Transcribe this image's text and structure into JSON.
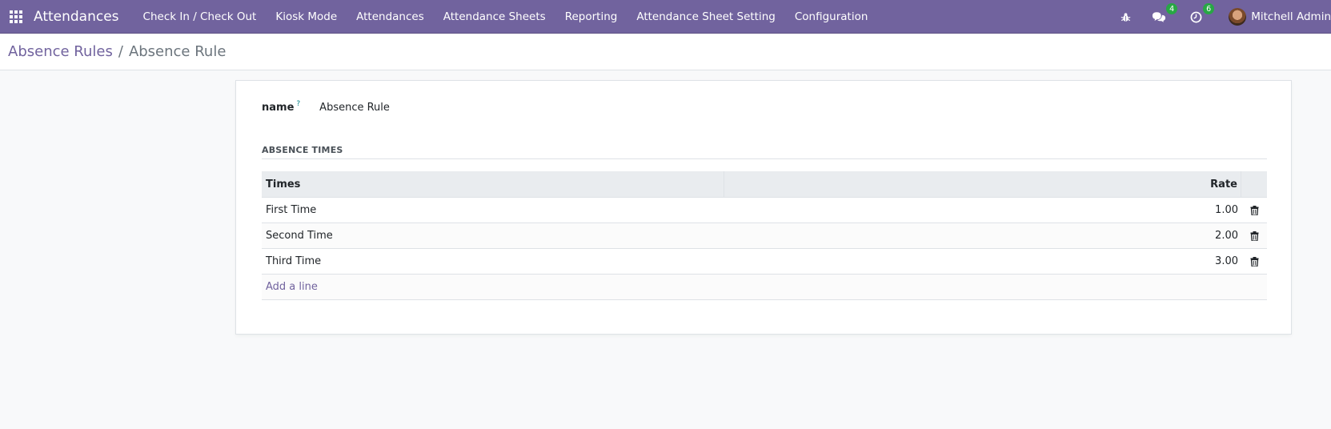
{
  "navbar": {
    "brand": "Attendances",
    "menu": [
      "Check In / Check Out",
      "Kiosk Mode",
      "Attendances",
      "Attendance Sheets",
      "Reporting",
      "Attendance Sheet Setting",
      "Configuration"
    ],
    "messages_count": "4",
    "activities_count": "6",
    "user_name": "Mitchell Admin"
  },
  "breadcrumb": {
    "parent": "Absence Rules",
    "separator": "/",
    "current": "Absence Rule"
  },
  "form": {
    "name_label": "name",
    "name_help": "?",
    "name_value": "Absence Rule",
    "section_title": "ABSENCE TIMES",
    "table": {
      "headers": {
        "times": "Times",
        "rate": "Rate"
      },
      "rows": [
        {
          "times": "First Time",
          "rate": "1.00"
        },
        {
          "times": "Second Time",
          "rate": "2.00"
        },
        {
          "times": "Third Time",
          "rate": "3.00"
        }
      ],
      "add_line": "Add a line"
    }
  },
  "colors": {
    "navbar": "#71639e",
    "accent": "#71639e",
    "badge": "#28a745"
  }
}
